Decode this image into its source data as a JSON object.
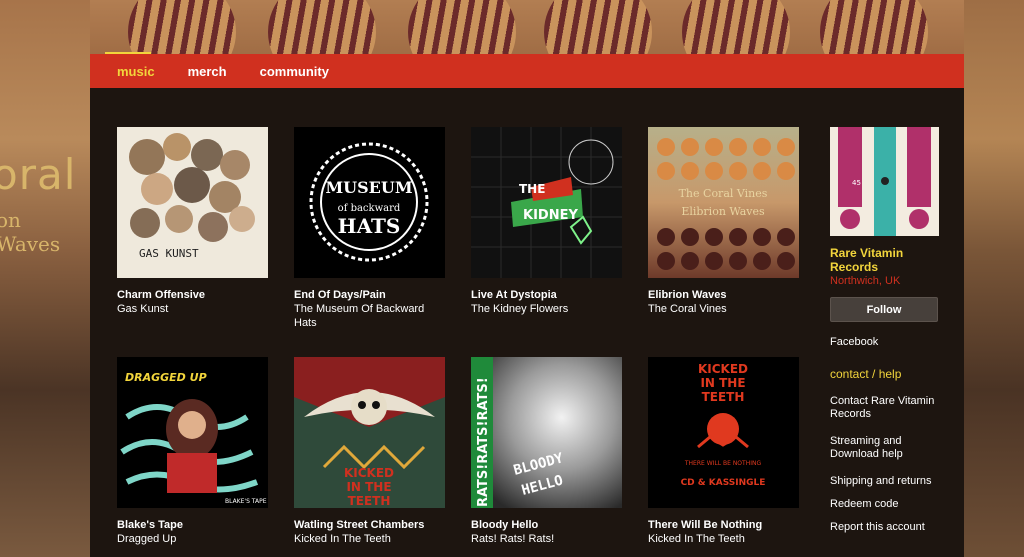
{
  "backdrop": {
    "word": "oral",
    "word2": "on Waves"
  },
  "nav": {
    "items": [
      {
        "label": "music",
        "active": true
      },
      {
        "label": "merch",
        "active": false
      },
      {
        "label": "community",
        "active": false
      }
    ]
  },
  "releases": [
    {
      "title": "Charm Offensive",
      "artist": "Gas Kunst",
      "cover_text": "GAS KUNST CHARM OFFENSIVE"
    },
    {
      "title": "End Of Days/Pain",
      "artist": "The Museum Of Backward Hats",
      "cover_text": "MUSEUM of backward HATS"
    },
    {
      "title": "Live At Dystopia",
      "artist": "The Kidney Flowers",
      "cover_text": "THE KIDNEY FLOWERS"
    },
    {
      "title": "Elibrion Waves",
      "artist": "The Coral Vines",
      "cover_text": "The Coral Vines Elibrion Waves"
    },
    {
      "title": "Blake's Tape",
      "artist": "Dragged Up",
      "cover_text": "DRAGGED UP",
      "cover_text2": "BLAKE'S TAPE"
    },
    {
      "title": "Watling Street Chambers",
      "artist": "Kicked In The Teeth",
      "cover_text": "KICKED IN THE TEETH"
    },
    {
      "title": "Bloody Hello",
      "artist": "Rats! Rats! Rats!",
      "cover_text": "RATS!RATS!RATS!",
      "cover_text2": "BLOODY HELLO"
    },
    {
      "title": "There Will Be Nothing",
      "artist": "Kicked In The Teeth",
      "cover_text": "KICKED IN THE TEETH",
      "cover_text2": "THERE WILL BE NOTHING",
      "cover_text3": "CD & KASSINGLE"
    }
  ],
  "label": {
    "name": "Rare Vitamin Records",
    "location": "Northwich, UK",
    "follow": "Follow",
    "facebook": "Facebook",
    "badge": "45"
  },
  "help": {
    "heading": "contact / help",
    "links": [
      "Contact Rare Vitamin Records",
      "Streaming and Download help",
      "Shipping and returns",
      "Redeem code",
      "Report this account"
    ]
  },
  "colors": {
    "accent": "#f2d53c",
    "nav": "#d0301f",
    "panel": "#1d1510"
  }
}
